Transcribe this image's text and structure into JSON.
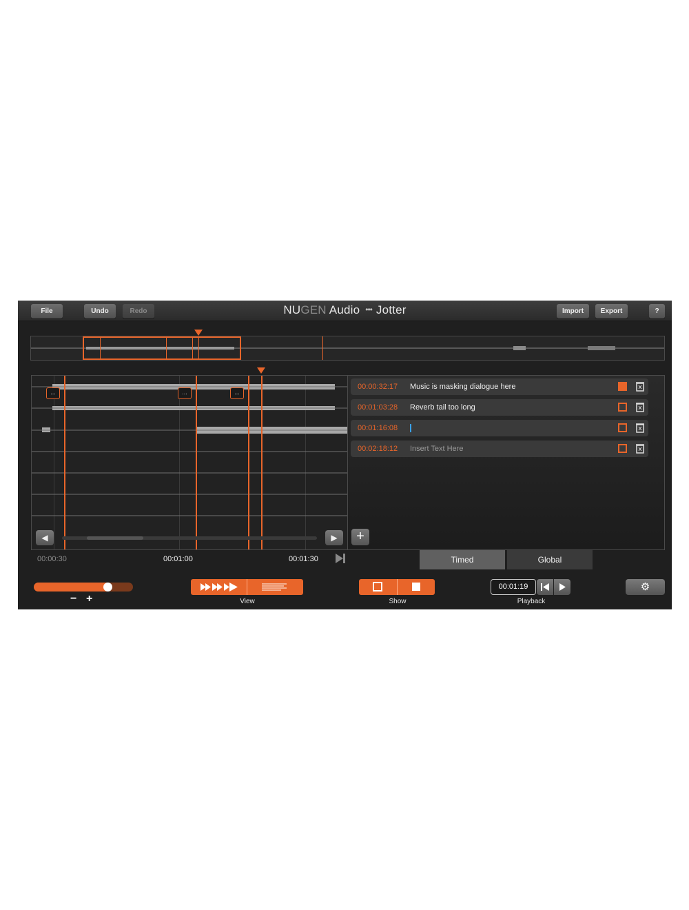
{
  "toolbar": {
    "file_label": "File",
    "undo_label": "Undo",
    "redo_label": "Redo",
    "import_label": "Import",
    "export_label": "Export",
    "help_label": "?"
  },
  "title": {
    "brand_nu": "NU",
    "brand_gen": "GEN",
    "brand_audio": "Audio",
    "dots": "•••",
    "app_name": "Jotter"
  },
  "waveform": {
    "note_flag_label": "...",
    "nav_left_icon": "◀",
    "nav_right_icon": "▶",
    "add_icon": "+"
  },
  "notes": [
    {
      "time": "00:00:32:17",
      "text": "Music is masking dialogue here",
      "checked": true
    },
    {
      "time": "00:01:03:28",
      "text": "Reverb tail too long",
      "checked": false
    },
    {
      "time": "00:01:16:08",
      "text": "",
      "checked": false,
      "editing": true
    },
    {
      "time": "00:02:18:12",
      "text": "Insert Text Here",
      "checked": false,
      "placeholder": true
    }
  ],
  "ruler": {
    "t1": "00:00:30",
    "t2": "00:01:00",
    "t3": "00:01:30"
  },
  "tabs": {
    "timed": "Timed",
    "global": "Global"
  },
  "bottom": {
    "zoom_minus": "−",
    "zoom_plus": "+",
    "zoom_level": 0.78,
    "view_label": "View",
    "show_label": "Show",
    "playback_label": "Playback",
    "playback_time": "00:01:19"
  },
  "colors": {
    "accent": "#e8652a",
    "background": "#1f1f1f",
    "caret": "#3aa0e8"
  }
}
